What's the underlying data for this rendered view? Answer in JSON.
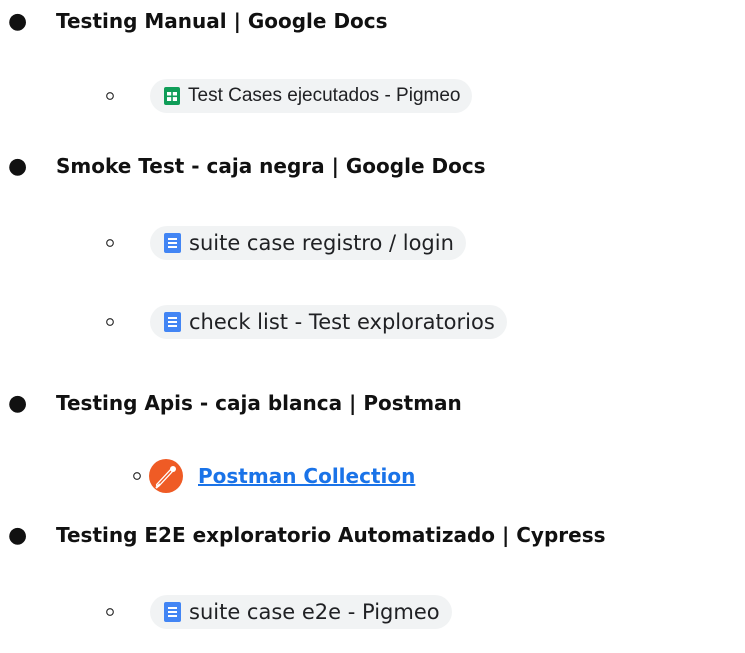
{
  "sections": [
    {
      "title": "Testing Manual | Google Docs"
    },
    {
      "title": "Smoke Test - caja negra | Google Docs"
    },
    {
      "title": "Testing Apis - caja blanca | Postman"
    },
    {
      "title": "Testing E2E exploratorio Automatizado | Cypress"
    }
  ],
  "chips": [
    {
      "label": "Test Cases ejecutados - Pigmeo",
      "icon": "google-sheets-icon",
      "color": "#0f9d58"
    },
    {
      "label": "suite case registro / login",
      "icon": "google-docs-icon",
      "color": "#4285f4"
    },
    {
      "label": "check list - Test exploratorios",
      "icon": "google-docs-icon",
      "color": "#4285f4"
    },
    {
      "label": "suite case e2e - Pigmeo",
      "icon": "google-docs-icon",
      "color": "#4285f4"
    }
  ],
  "link": {
    "label": "Postman Collection",
    "icon": "postman-icon",
    "color": "#1a73e8"
  },
  "bullet_char": "●"
}
